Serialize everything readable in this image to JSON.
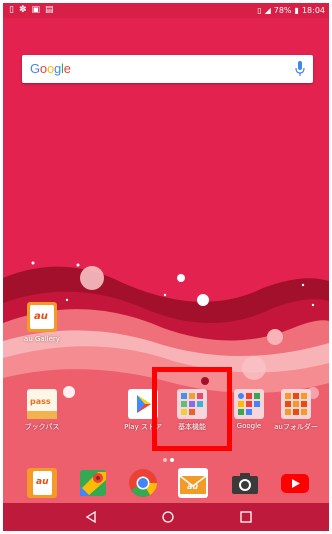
{
  "status_bar": {
    "left_icons": [
      "phone-icon",
      "settings-icon",
      "image-icon",
      "inbox-icon"
    ],
    "battery": "78%",
    "time": "18:04"
  },
  "search": {
    "logo": [
      "G",
      "o",
      "o",
      "g",
      "l",
      "e"
    ]
  },
  "apps": {
    "au_gallery": "au Gallery",
    "bookpass": "ブックパス",
    "play_store": "Play ストア",
    "kihon_kinou": "基本機能",
    "google": "Google",
    "au_folder": "auフォルダー"
  },
  "icon_texts": {
    "au": "au",
    "pass": "pass"
  },
  "colors": {
    "background": "#e3224f",
    "status_bar": "#d81f46",
    "highlight": "#ff0000",
    "nav_bar": "#bd1a3c"
  }
}
